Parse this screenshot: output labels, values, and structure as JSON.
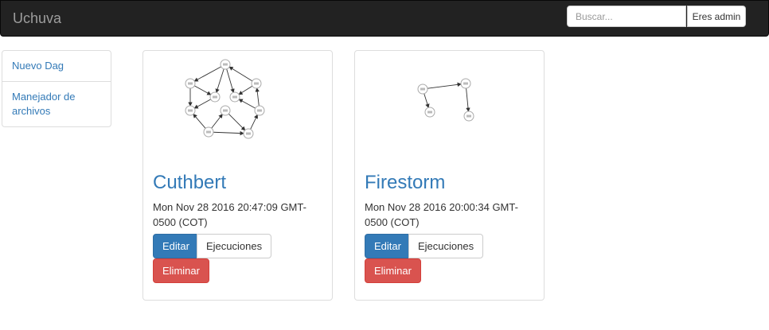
{
  "navbar": {
    "brand": "Uchuva",
    "search_placeholder": "Buscar...",
    "user_button": "Eres admin"
  },
  "sidebar": {
    "items": [
      {
        "label": "Nuevo Dag"
      },
      {
        "label": "Manejador de archivos"
      }
    ]
  },
  "dags": [
    {
      "name": "Cuthbert",
      "date": "Mon Nov 28 2016 20:47:09 GMT-0500 (COT)",
      "edit": "Editar",
      "runs": "Ejecuciones",
      "delete": "Eliminar"
    },
    {
      "name": "Firestorm",
      "date": "Mon Nov 28 2016 20:00:34 GMT-0500 (COT)",
      "edit": "Editar",
      "runs": "Ejecuciones",
      "delete": "Eliminar"
    }
  ]
}
